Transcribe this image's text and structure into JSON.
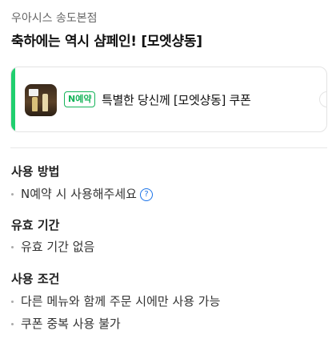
{
  "header": {
    "store_name": "우아시스 송도본점",
    "title": "축하에는 역시 샴페인! [모엣샹동]"
  },
  "coupon": {
    "badge": "N예약",
    "text": "특별한 당신께 [모엣샹동] 쿠폰",
    "accent_color": "#1fcf6e"
  },
  "sections": [
    {
      "title": "사용 방법",
      "items": [
        "N예약 시 사용해주세요"
      ]
    },
    {
      "title": "유효 기간",
      "items": [
        "유효 기간 없음"
      ]
    },
    {
      "title": "사용 조건",
      "items": [
        "다른 메뉴와 함께 주문 시에만 사용 가능",
        "쿠폰 중복 사용 불가"
      ]
    }
  ],
  "icons": {
    "help": "help-icon",
    "help_glyph": "?"
  }
}
